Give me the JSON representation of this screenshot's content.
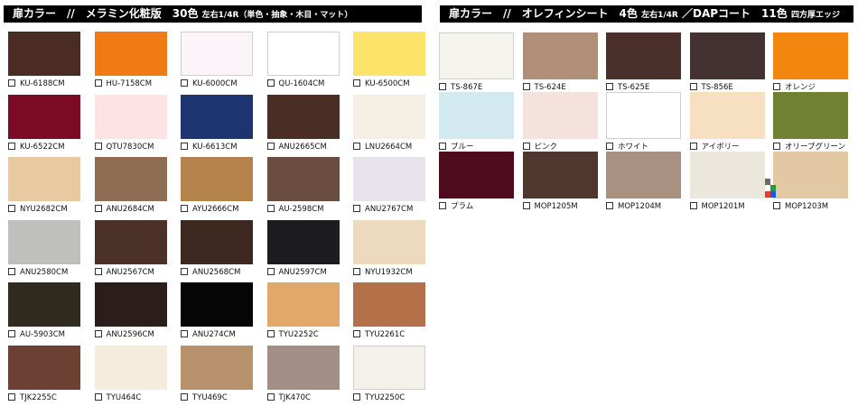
{
  "left_header": {
    "title": "扉カラー　//　メラミン化粧版　30色",
    "subtitle": "左右1/4R（単色・抽象・木目・マット）"
  },
  "right_header": {
    "title": "扉カラー　//　オレフィンシート　4色",
    "subtitle1": "左右1/4R",
    "title2": "／DAPコート　11色",
    "subtitle2": "四方厚エッジ"
  },
  "left_swatches": [
    {
      "code": "KU-6188CM",
      "color": "#4a2c24"
    },
    {
      "code": "HU-7158CM",
      "color": "#f07a14"
    },
    {
      "code": "KU-6000CM",
      "color": "#fbf4f9"
    },
    {
      "code": "QU-1604CM",
      "color": "#ffffff"
    },
    {
      "code": "KU-6500CM",
      "color": "#fce36a"
    },
    {
      "code": "KU-6522CM",
      "color": "#7b0a27"
    },
    {
      "code": "QTU7830CM",
      "color": "#fde3e6"
    },
    {
      "code": "KU-6613CM",
      "color": "#1c3470"
    },
    {
      "code": "ANU2665CM",
      "color": "#4a2e26"
    },
    {
      "code": "LNU2664CM",
      "color": "#f4efe2"
    },
    {
      "code": "NYU2682CM",
      "color": "#e8caa0"
    },
    {
      "code": "ANU2684CM",
      "color": "#8e6d54"
    },
    {
      "code": "AYU2666CM",
      "color": "#b6834f"
    },
    {
      "code": "AU-2598CM",
      "color": "#6a4d3e"
    },
    {
      "code": "ANU2767CM",
      "color": "#e7e3ec"
    },
    {
      "code": "ANU2580CM",
      "color": "#bfc0be"
    },
    {
      "code": "ANU2567CM",
      "color": "#4c3129"
    },
    {
      "code": "ANU2568CM",
      "color": "#3d2820"
    },
    {
      "code": "ANU2597CM",
      "color": "#1d1d20"
    },
    {
      "code": "NYU1932CM",
      "color": "#edd9bd"
    },
    {
      "code": "AU-5903CM",
      "color": "#2f2b1f"
    },
    {
      "code": "ANU2596CM",
      "color": "#2b1d1a"
    },
    {
      "code": "ANU274CM",
      "color": "#050505"
    },
    {
      "code": "TYU2252C",
      "color": "#e2a869"
    },
    {
      "code": "TYU2261C",
      "color": "#b37049"
    },
    {
      "code": "TJK2255C",
      "color": "#6c4033"
    },
    {
      "code": "TYU464C",
      "color": "#f6ecde"
    },
    {
      "code": "TYU469C",
      "color": "#b8926d"
    },
    {
      "code": "TJK470C",
      "color": "#a48f87"
    },
    {
      "code": "TYU2250C",
      "color": "#f4f0ea"
    }
  ],
  "right_swatches": [
    {
      "code": "TS-867E",
      "color": "#f5f3ee"
    },
    {
      "code": "TS-624E",
      "color": "#b08f79"
    },
    {
      "code": "TS-625E",
      "color": "#4b2f2a"
    },
    {
      "code": "TS-856E",
      "color": "#443232"
    },
    {
      "code": "オレンジ",
      "color": "#f2860f"
    },
    {
      "code": "ブルー",
      "color": "#d2eaef"
    },
    {
      "code": "ピンク",
      "color": "#f6e2dc"
    },
    {
      "code": "ホワイト",
      "color": "#ffffff"
    },
    {
      "code": "アイボリー",
      "color": "#f6e0c1"
    },
    {
      "code": "オリーブグリーン",
      "color": "#708134"
    },
    {
      "code": "プラム",
      "color": "#4e0b1d"
    },
    {
      "code": "MOP1205M",
      "color": "#4f372d"
    },
    {
      "code": "MOP1204M",
      "color": "#aa9081"
    },
    {
      "code": "MOP1201M",
      "color": "#ece7dc"
    },
    {
      "code": "MOP1203M",
      "color": "#e2c8a3"
    }
  ]
}
